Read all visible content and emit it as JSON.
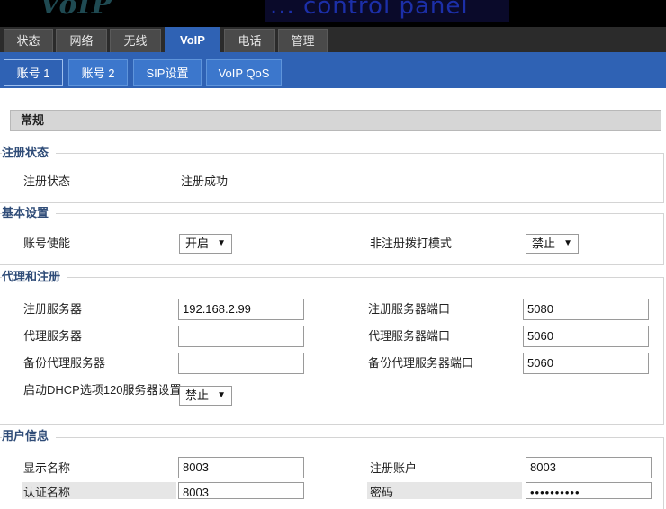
{
  "header": {
    "logo": "VoIP",
    "title": "... control panel"
  },
  "main_tabs": [
    {
      "label": "状态"
    },
    {
      "label": "网络"
    },
    {
      "label": "无线"
    },
    {
      "label": "VoIP"
    },
    {
      "label": "电话"
    },
    {
      "label": "管理"
    }
  ],
  "sub_tabs": [
    {
      "label": "账号 1"
    },
    {
      "label": "账号 2"
    },
    {
      "label": "SIP设置"
    },
    {
      "label": "VoIP QoS"
    }
  ],
  "section_title": "常规",
  "reg_status": {
    "legend": "注册状态",
    "label": "注册状态",
    "value": "注册成功"
  },
  "basic": {
    "legend": "基本设置",
    "account_enable_label": "账号使能",
    "account_enable_value": "开启",
    "nonreg_dial_label": "非注册拨打模式",
    "nonreg_dial_value": "禁止"
  },
  "proxy": {
    "legend": "代理和注册",
    "reg_server_label": "注册服务器",
    "reg_server_value": "192.168.2.99",
    "reg_port_label": "注册服务器端口",
    "reg_port_value": "5080",
    "proxy_server_label": "代理服务器",
    "proxy_server_value": "",
    "proxy_port_label": "代理服务器端口",
    "proxy_port_value": "5060",
    "backup_proxy_label": "备份代理服务器",
    "backup_proxy_value": "",
    "backup_port_label": "备份代理服务器端口",
    "backup_port_value": "5060",
    "dhcp120_label": "启动DHCP选项120服务器设置",
    "dhcp120_value": "禁止"
  },
  "user": {
    "legend": "用户信息",
    "display_name_label": "显示名称",
    "display_name_value": "8003",
    "reg_account_label": "注册账户",
    "reg_account_value": "8003",
    "auth_name_label": "认证名称",
    "auth_name_value": "8003",
    "password_label": "密码",
    "password_value": "••••••••••"
  }
}
